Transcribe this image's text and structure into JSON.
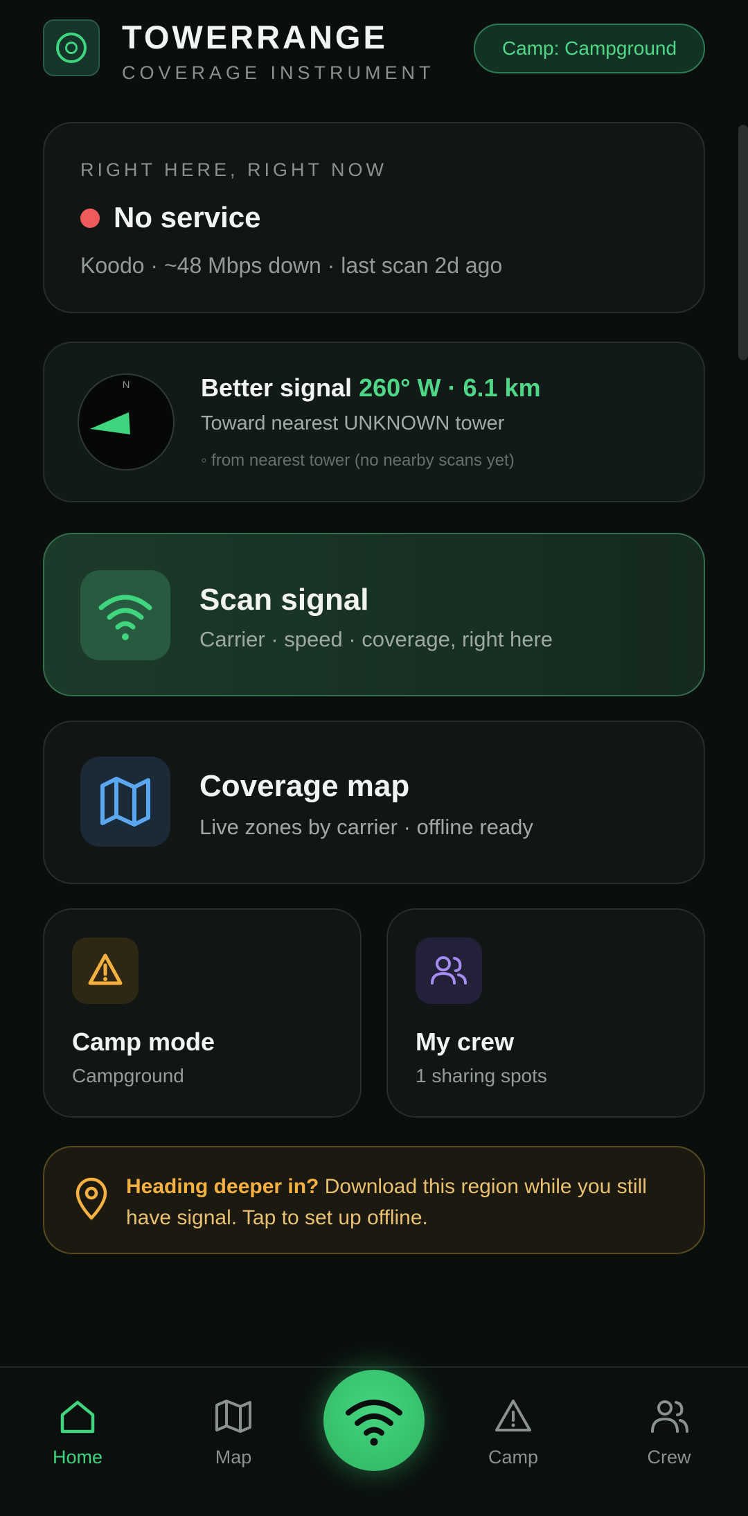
{
  "header": {
    "title": "TOWERRANGE",
    "subtitle": "COVERAGE INSTRUMENT",
    "camp_pill": "Camp: Campground"
  },
  "status": {
    "eyebrow": "RIGHT HERE, RIGHT NOW",
    "title": "No service",
    "detail": "Koodo · ~48 Mbps down · last scan 2d ago",
    "status_color": "#ef5a5a"
  },
  "better_signal": {
    "compass_label": "N",
    "title_prefix": "Better signal",
    "title_accent": "260° W · 6.1 km",
    "subtitle": "Toward nearest UNKNOWN tower",
    "note": "◦ from nearest tower (no nearby scans yet)"
  },
  "scan": {
    "title": "Scan signal",
    "subtitle": "Carrier · speed · coverage, right here"
  },
  "coverage_map": {
    "title": "Coverage map",
    "subtitle": "Live zones by carrier · offline ready"
  },
  "camp_mode": {
    "title": "Camp mode",
    "subtitle": "Campground"
  },
  "crew": {
    "title": "My crew",
    "subtitle": "1 sharing spots"
  },
  "offline_banner": {
    "bold": "Heading deeper in?",
    "text": " Download this region while you still have signal. Tap to set up offline."
  },
  "nav": {
    "home": "Home",
    "map": "Map",
    "camp": "Camp",
    "crew": "Crew"
  },
  "colors": {
    "accent": "#3fd47e",
    "warning": "#f4b040",
    "map_blue": "#5aa6f0",
    "crew_purple": "#a48cf0"
  }
}
